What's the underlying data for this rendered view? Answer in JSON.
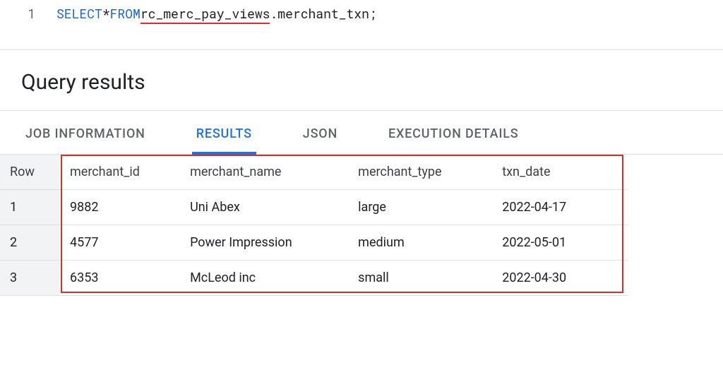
{
  "editor": {
    "line_number": "1",
    "kw_select": "SELECT",
    "star": " * ",
    "kw_from": "FROM",
    "space1": " ",
    "dataset": "rc_merc_pay_views",
    "dot_table": ".merchant_txn;"
  },
  "results_header": {
    "title": "Query results"
  },
  "tabs": {
    "job_info": "JOB INFORMATION",
    "results": "RESULTS",
    "json": "JSON",
    "execution": "EXECUTION DETAILS"
  },
  "table": {
    "headers": {
      "row": "Row",
      "merchant_id": "merchant_id",
      "merchant_name": "merchant_name",
      "merchant_type": "merchant_type",
      "txn_date": "txn_date"
    },
    "rows": [
      {
        "row": "1",
        "merchant_id": "9882",
        "merchant_name": "Uni Abex",
        "merchant_type": "large",
        "txn_date": "2022-04-17"
      },
      {
        "row": "2",
        "merchant_id": "4577",
        "merchant_name": "Power Impression",
        "merchant_type": "medium",
        "txn_date": "2022-05-01"
      },
      {
        "row": "3",
        "merchant_id": "6353",
        "merchant_name": "McLeod inc",
        "merchant_type": "small",
        "txn_date": "2022-04-30"
      }
    ]
  }
}
